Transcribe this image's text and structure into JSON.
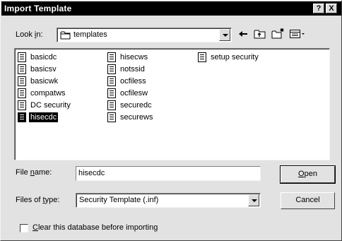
{
  "window": {
    "title": "Import Template",
    "help_label": "?",
    "close_label": "X"
  },
  "look_in": {
    "label_pre": "Look ",
    "label_key": "i",
    "label_post": "n:",
    "value": "templates",
    "icon": "folder-icon"
  },
  "toolbar": {
    "back_icon": "back-arrow-icon",
    "up_icon": "up-folder-icon",
    "new_folder_icon": "new-folder-icon",
    "view_icon": "view-menu-icon"
  },
  "files": {
    "columns": [
      [
        "basicdc",
        "basicsv",
        "basicwk",
        "compatws",
        "DC security",
        "hisecdc"
      ],
      [
        "hisecws",
        "notssid",
        "ocfiless",
        "ocfilesw",
        "securedc",
        "securews"
      ],
      [
        "setup security"
      ]
    ],
    "selected": "hisecdc"
  },
  "file_name": {
    "label_pre": "File ",
    "label_key": "n",
    "label_post": "ame:",
    "value": "hisecdc"
  },
  "file_type": {
    "label_pre": "Files of ",
    "label_key": "t",
    "label_post": "ype:",
    "value": "Security Template (.inf)"
  },
  "buttons": {
    "open_key": "O",
    "open_rest": "pen",
    "cancel": "Cancel"
  },
  "clear_db": {
    "label_key": "C",
    "label_rest": "lear this database before importing",
    "checked": false
  }
}
